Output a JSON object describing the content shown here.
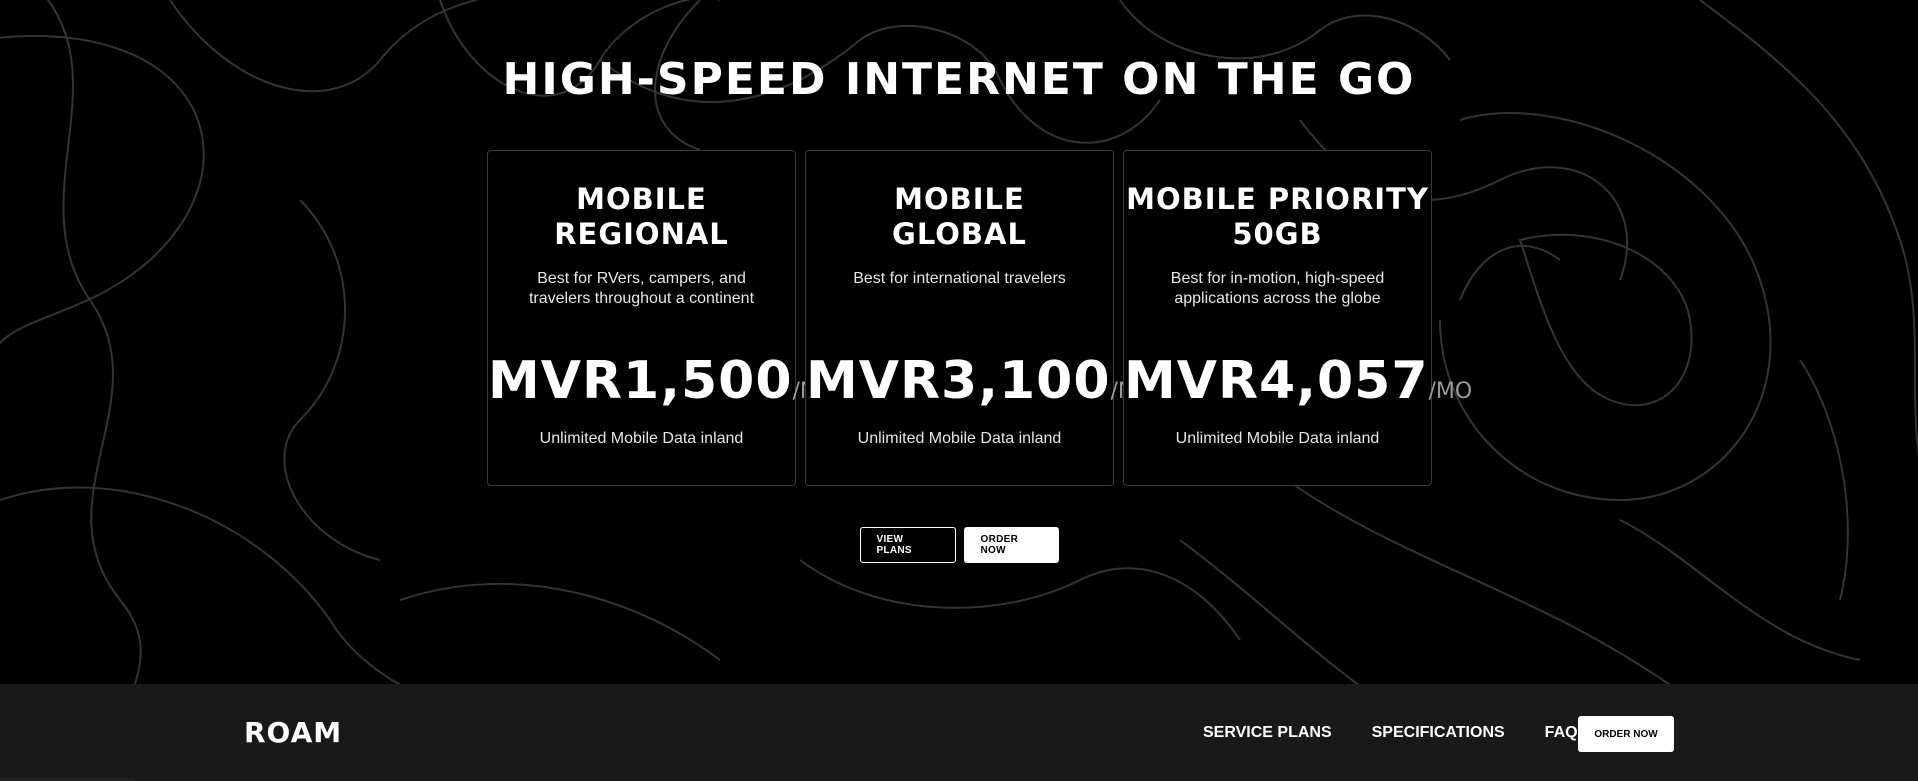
{
  "hero": {
    "headline": "HIGH-SPEED INTERNET ON THE GO"
  },
  "plans": [
    {
      "title_line1": "MOBILE",
      "title_line2": "REGIONAL",
      "description": "Best for RVers, campers, and travelers throughout a continent",
      "price": "MVR1,500",
      "unit": "/MO",
      "feature": "Unlimited Mobile Data inland"
    },
    {
      "title_line1": "MOBILE",
      "title_line2": "GLOBAL",
      "description": "Best for international travelers",
      "price": "MVR3,100",
      "unit": "/MO",
      "feature": "Unlimited Mobile Data inland"
    },
    {
      "title_line1": "MOBILE PRIORITY",
      "title_line2": "50GB",
      "description": "Best for in-motion, high-speed applications across the globe",
      "price": "MVR4,057",
      "unit": "/MO",
      "feature": "Unlimited Mobile Data inland"
    }
  ],
  "cta": {
    "view_plans": "VIEW PLANS",
    "order_now": "ORDER NOW"
  },
  "footer": {
    "logo": "ROAM",
    "nav": [
      "SERVICE PLANS",
      "SPECIFICATIONS",
      "FAQS"
    ],
    "order_now": "ORDER NOW"
  },
  "colors": {
    "background": "#000000",
    "footer_bg": "#191919",
    "card_border": "#3a3a3a",
    "accent": "#ffffff",
    "unit_text": "#9a9a9a"
  }
}
